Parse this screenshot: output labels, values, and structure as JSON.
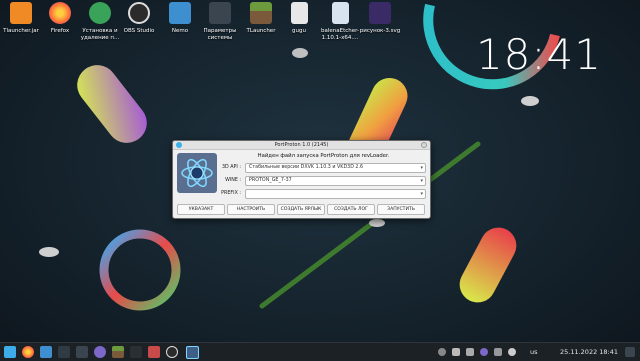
{
  "desktop": {
    "icons": [
      {
        "label": "Tlauncher.jar",
        "icon": "tlauncher-jar-icon",
        "color": "#f08a24"
      },
      {
        "label": "Firefox",
        "icon": "firefox-icon",
        "color": "#ff7139"
      },
      {
        "label": "Установка и удаление п...",
        "icon": "install-remove-icon",
        "color": "#3aa35a"
      },
      {
        "label": "OBS Studio",
        "icon": "obs-icon",
        "color": "#2b2b2b"
      },
      {
        "label": "Nemo",
        "icon": "folder-icon",
        "color": "#3e8fd0"
      },
      {
        "label": "Параметры системы",
        "icon": "settings-icon",
        "color": "#3a4550"
      },
      {
        "label": "TLauncher",
        "icon": "minecraft-icon",
        "color": "#6c9a3c"
      },
      {
        "label": "gugu",
        "icon": "document-icon",
        "color": "#e8e8e8"
      },
      {
        "label": "balenaEtcher-1.10.1-x64....",
        "icon": "archive-icon",
        "color": "#d8e4f0"
      },
      {
        "label": "рисунок-3.svg",
        "icon": "svg-image-icon",
        "color": "#3a2a66"
      }
    ]
  },
  "clock": {
    "time": "18:41"
  },
  "dialog": {
    "title": "PortProton 1.0 (2145)",
    "message": "Найден файл запуска PortProton для revLoader.",
    "fields": [
      {
        "key": "3D API :",
        "value": "Стабильные версии DXVK 1.10.3 и VKD3D 2.6"
      },
      {
        "key": "WINE :",
        "value": "PROTON_GE_7-37"
      },
      {
        "key": "PREFIX :",
        "value": ""
      }
    ],
    "buttons": [
      "УКВАЗАКТ",
      "НАСТРОИТЬ",
      "СОЗДАТЬ ЯРЛЫК",
      "СОЗДАТЬ ЛОГ",
      "ЗАПУСТИТЬ"
    ]
  },
  "taskbar": {
    "tray_lang": "us",
    "datetime": "25.11.2022 18:41"
  }
}
